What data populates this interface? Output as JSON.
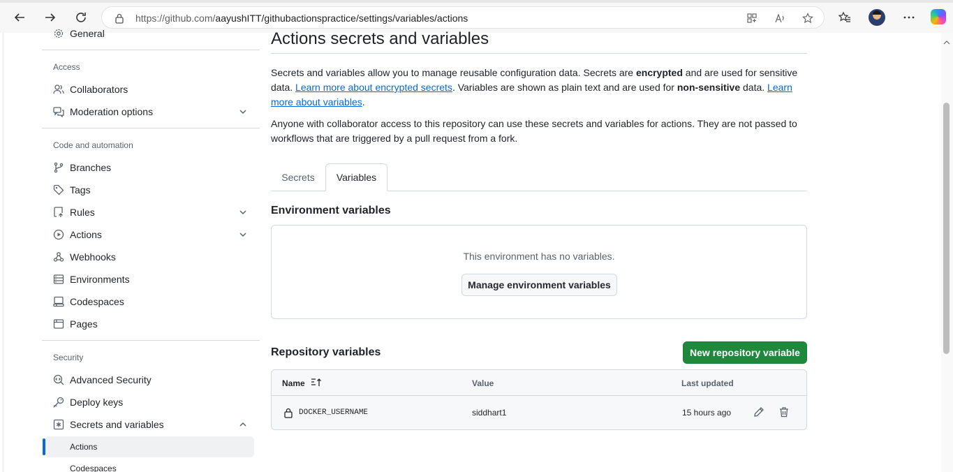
{
  "browser": {
    "url_host": "https://github.com/",
    "url_path": "aayushITT/githubactionspractice/settings/variables/actions"
  },
  "sidebar": {
    "general_label": "General",
    "access_heading": "Access",
    "collaborators_label": "Collaborators",
    "moderation_label": "Moderation options",
    "code_heading": "Code and automation",
    "branches_label": "Branches",
    "tags_label": "Tags",
    "rules_label": "Rules",
    "actions_label": "Actions",
    "webhooks_label": "Webhooks",
    "environments_label": "Environments",
    "codespaces_label": "Codespaces",
    "pages_label": "Pages",
    "security_heading": "Security",
    "advanced_security_label": "Advanced Security",
    "deploy_keys_label": "Deploy keys",
    "secrets_label": "Secrets and variables",
    "sub_actions_label": "Actions",
    "sub_codespaces_label": "Codespaces"
  },
  "main": {
    "title": "Actions secrets and variables",
    "intro_1a": "Secrets and variables allow you to manage reusable configuration data. Secrets are ",
    "intro_1b": "encrypted",
    "intro_1c": " and are used for sensitive data. ",
    "intro_link1": "Learn more about encrypted secrets",
    "intro_1d": ". Variables are shown as plain text and are used for ",
    "intro_1e": "non-sensitive",
    "intro_1f": " data. ",
    "intro_link2": "Learn more about variables",
    "intro_1g": ".",
    "intro_2": "Anyone with collaborator access to this repository can use these secrets and variables for actions. They are not passed to workflows that are triggered by a pull request from a fork.",
    "tabs": [
      {
        "label": "Secrets"
      },
      {
        "label": "Variables"
      }
    ],
    "env_title": "Environment variables",
    "env_empty": "This environment has no variables.",
    "env_button": "Manage environment variables",
    "repo_title": "Repository variables",
    "new_var_button": "New repository variable",
    "table": {
      "col_name": "Name",
      "col_value": "Value",
      "col_updated": "Last updated",
      "rows": [
        {
          "name": "DOCKER_USERNAME",
          "value": "siddhart1",
          "updated": "15 hours ago"
        }
      ]
    }
  },
  "colors": {
    "primary_button": "#1f883d",
    "link": "#0969da",
    "active_indicator": "#0969da"
  }
}
